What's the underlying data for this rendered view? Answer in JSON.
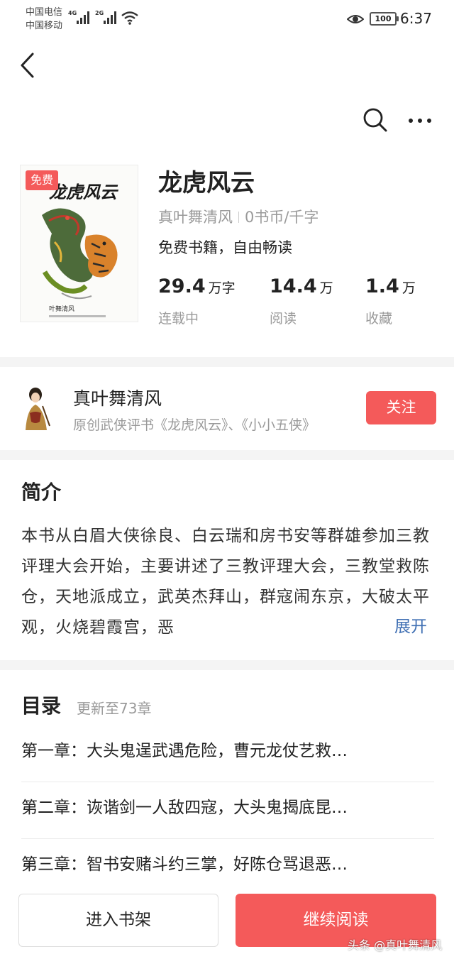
{
  "status_bar": {
    "carrier_1": "中国电信",
    "carrier_2": "中国移动",
    "net_1": "4G",
    "net_2": "2G",
    "battery": "100",
    "time": "6:37"
  },
  "book": {
    "badge": "免费",
    "title": "龙虎风云",
    "author": "真叶舞清风",
    "price": "0书币/千字",
    "tagline": "免费书籍，自由畅读",
    "cover_title": "龙虎风云",
    "cover_author": "叶舞清风",
    "stats": [
      {
        "number": "29.4",
        "unit": "万字",
        "label": "连载中"
      },
      {
        "number": "14.4",
        "unit": "万",
        "label": "阅读"
      },
      {
        "number": "1.4",
        "unit": "万",
        "label": "收藏"
      }
    ]
  },
  "author_card": {
    "name": "真叶舞清风",
    "description": "原创武侠评书《龙虎风云》、《小小五侠》",
    "follow_label": "关注"
  },
  "intro": {
    "heading": "简介",
    "text": "本书从白眉大侠徐良、白云瑞和房书安等群雄参加三教评理大会开始，主要讲述了三教评理大会，三教堂救陈仓，天地派成立，武英杰拜山，群寇闹东京，大破太平观，火烧碧霞宫，恶",
    "expand_label": "展开"
  },
  "catalog": {
    "heading": "目录",
    "update_text": "更新至73章",
    "chapters": [
      "第一章：大头鬼逞武遇危险，曹元龙仗艺救…",
      "第二章：诙谐剑一人敌四寇，大头鬼揭底昆…",
      "第三章：智书安赌斗约三掌，好陈仓骂退恶…"
    ]
  },
  "bottom_bar": {
    "shelf_label": "进入书架",
    "read_label": "继续阅读"
  },
  "watermark": "头条 @真叶舞清风",
  "colors": {
    "accent": "#f45a5a",
    "link": "#3f6fb3",
    "muted": "#9a9a9a"
  }
}
